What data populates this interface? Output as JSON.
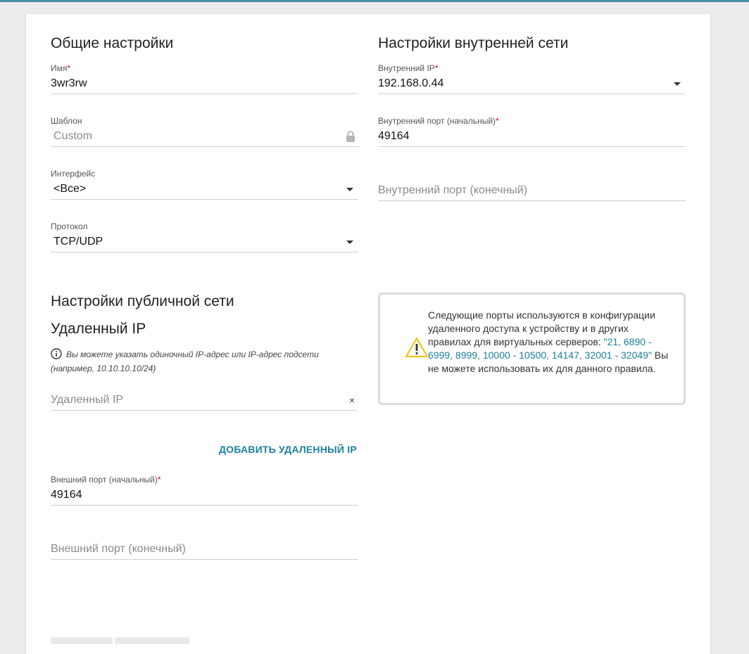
{
  "general": {
    "title": "Общие настройки",
    "name": {
      "label": "Имя",
      "required": "*",
      "value": "3wr3rw"
    },
    "template": {
      "label": "Шаблон",
      "value": "Custom"
    },
    "interface": {
      "label": "Интерфейс",
      "value": "<Все>"
    },
    "protocol": {
      "label": "Протокол",
      "value": "TCP/UDP"
    }
  },
  "internal": {
    "title": "Настройки внутренней сети",
    "ip": {
      "label": "Внутренний IP",
      "required": "*",
      "value": "192.168.0.44"
    },
    "port_start": {
      "label": "Внутренний порт (начальный)",
      "required": "*",
      "value": "49164"
    },
    "port_end": {
      "placeholder": "Внутренний порт (конечный)"
    }
  },
  "public": {
    "title": "Настройки публичной сети",
    "remote_ip_title": "Удаленный IP",
    "hint": "Вы можете указать одиночный IP-адрес или IP-адрес подсети (например, 10.10.10.10/24)",
    "remote_ip_placeholder": "Удаленный IP",
    "clear_symbol": "×",
    "add_remote_ip": "ДОБАВИТЬ УДАЛЕННЫЙ IP",
    "ext_port_start": {
      "label": "Внешний порт (начальный)",
      "required": "*",
      "value": "49164"
    },
    "ext_port_end": {
      "placeholder": "Внешний порт (конечный)"
    }
  },
  "warning": {
    "text_before": "Следующие порты используются в конфигурации удаленного доступа к устройству и в других правилах для виртуальных серверов: ",
    "ports": "\"21, 6890 - 6999, 8999, 10000 - 10500, 14147, 32001 - 32049\"",
    "text_after": " Вы не можете использовать их для данного правила."
  },
  "colors": {
    "accent": "#1b7f9e",
    "required": "#d0021b",
    "warning_icon": "#f0c419"
  }
}
